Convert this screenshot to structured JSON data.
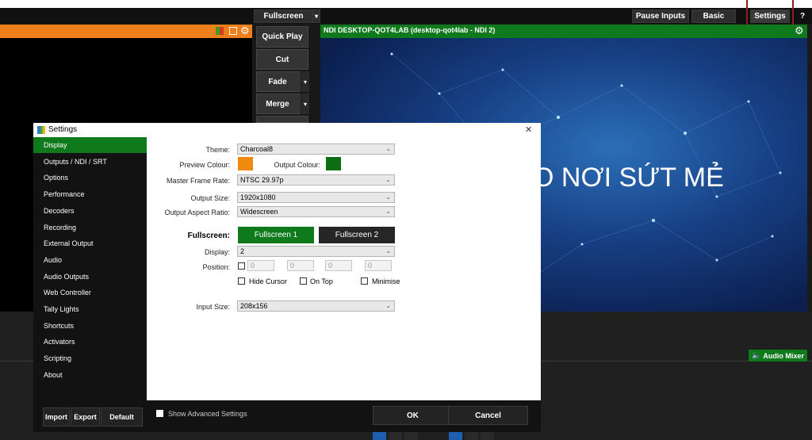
{
  "topbar": {
    "fullscreen_label": "Fullscreen",
    "fullscreen_dropdown": "▾",
    "pause_inputs_label": "Pause Inputs",
    "basic_label": "Basic",
    "settings_label": "Settings",
    "help_label": "?"
  },
  "transitions": {
    "quick_play": "Quick Play",
    "cut": "Cut",
    "fade": "Fade",
    "merge": "Merge",
    "dropdown_glyph": "▾"
  },
  "output": {
    "title": "NDI DESKTOP-QOT4LAB (desktop-qot4lab - NDI 2)",
    "overlay_text": "O NƠI SỨT MẺ"
  },
  "audio_mixer": {
    "label": "Audio Mixer",
    "icon": "speaker-icon"
  },
  "settings_dialog": {
    "title": "Settings",
    "close_glyph": "✕",
    "sidebar": {
      "items": [
        {
          "label": "Display",
          "active": true
        },
        {
          "label": "Outputs / NDI / SRT"
        },
        {
          "label": "Options"
        },
        {
          "label": "Performance"
        },
        {
          "label": "Decoders"
        },
        {
          "label": "Recording"
        },
        {
          "label": "External Output"
        },
        {
          "label": "Audio"
        },
        {
          "label": "Audio Outputs"
        },
        {
          "label": "Web Controller"
        },
        {
          "label": "Tally Lights"
        },
        {
          "label": "Shortcuts"
        },
        {
          "label": "Activators"
        },
        {
          "label": "Scripting"
        },
        {
          "label": "About"
        }
      ],
      "import_label": "Import",
      "export_label": "Export",
      "default_label": "Default"
    },
    "display": {
      "theme_label": "Theme:",
      "theme_value": "Charcoal8",
      "preview_colour_label": "Preview Colour:",
      "preview_colour": "#f08a0c",
      "output_colour_label": "Output Colour:",
      "output_colour": "#0b6e13",
      "frame_rate_label": "Master Frame Rate:",
      "frame_rate_value": "NTSC 29.97p",
      "output_size_label": "Output Size:",
      "output_size_value": "1920x1080",
      "aspect_label": "Output Aspect Ratio:",
      "aspect_value": "Widescreen",
      "fullscreen_label": "Fullscreen:",
      "fullscreen1": "Fullscreen 1",
      "fullscreen2": "Fullscreen 2",
      "display_label": "Display:",
      "display_value": "2",
      "position_label": "Position:",
      "position_values": [
        "0",
        "0",
        "0",
        "0"
      ],
      "hide_cursor_label": "Hide Cursor",
      "on_top_label": "On Top",
      "minimise_label": "Minimise",
      "input_size_label": "Input Size:",
      "input_size_value": "208x156"
    },
    "show_advanced_label": "Show Advanced Settings",
    "ok_label": "OK",
    "cancel_label": "Cancel"
  },
  "colors": {
    "preview_header": "#ee7f1b",
    "output_header": "#0f7a1c",
    "active_item": "#0f7a1c",
    "highlight_border": "#8b1f24"
  }
}
